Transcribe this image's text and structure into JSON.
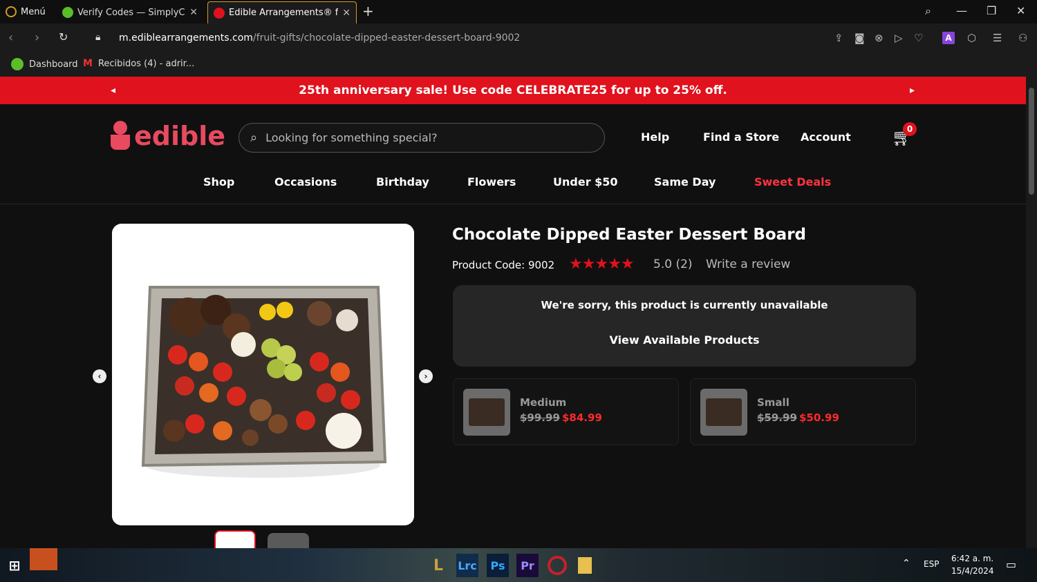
{
  "browser": {
    "menu_label": "Menú",
    "tabs": [
      {
        "title": "Verify Codes — SimplyCod",
        "active": false
      },
      {
        "title": "Edible Arrangements® frui",
        "active": true
      }
    ],
    "url_domain": "m.ediblearrangements.com",
    "url_path": "/fruit-gifts/chocolate-dipped-easter-dessert-board-9002",
    "bookmarks": [
      {
        "label": "Dashboard",
        "icon": "dashboard-icon"
      },
      {
        "label": "Recibidos (4) - adrir...",
        "icon": "gmail-icon"
      }
    ],
    "extension_letter": "A"
  },
  "promo": {
    "text": "25th anniversary sale! Use code CELEBRATE25 for up to 25% off."
  },
  "header": {
    "logo_text": "edible",
    "search_placeholder": "Looking for something special?",
    "links": [
      "Help",
      "Find a Store",
      "Account"
    ],
    "cart_count": "0"
  },
  "nav": {
    "items": [
      "Shop",
      "Occasions",
      "Birthday",
      "Flowers",
      "Under $50",
      "Same Day",
      "Sweet Deals"
    ]
  },
  "product": {
    "title": "Chocolate Dipped Easter Dessert Board",
    "code_label": "Product Code: 9002",
    "stars": "★★★★★",
    "rating": "5.0 (2)",
    "review_link": "Write a review",
    "unavailable_msg": "We're sorry, this product is currently unavailable",
    "view_available": "View Available Products",
    "sizes": [
      {
        "name": "Medium",
        "old_price": "$99.99",
        "new_price": "$84.99"
      },
      {
        "name": "Small",
        "old_price": "$59.99",
        "new_price": "$50.99"
      }
    ]
  },
  "taskbar": {
    "apps": [
      "Lrc",
      "Ps",
      "Pr"
    ],
    "language": "ESP",
    "time": "6:42 a. m.",
    "date": "15/4/2024"
  },
  "colors": {
    "brand_red": "#e0121d",
    "logo_pink": "#e84a5f",
    "sale_price": "#ff2a2a"
  }
}
